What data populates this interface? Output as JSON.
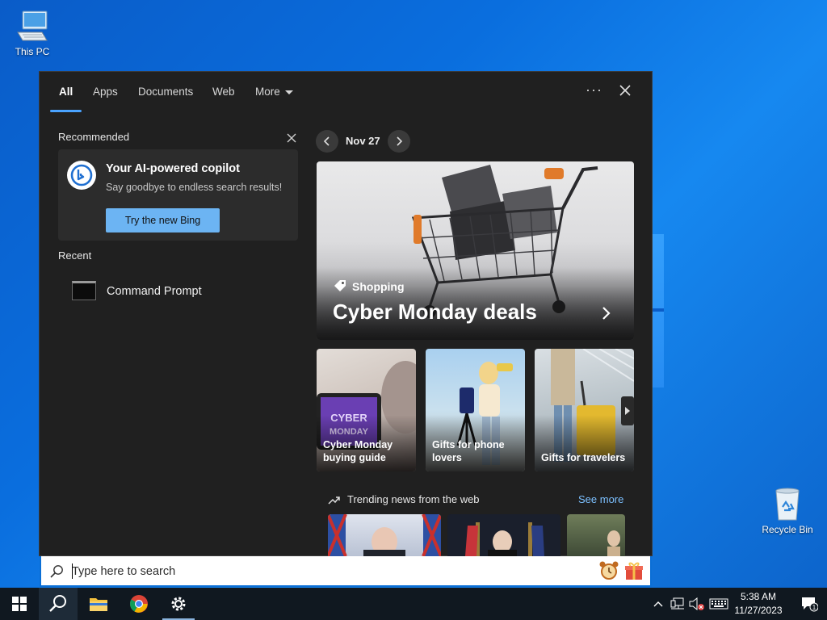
{
  "desktop": {
    "icons": [
      {
        "label": "This PC"
      },
      {
        "label": "Recycle Bin"
      }
    ]
  },
  "search_flyout": {
    "tabs": [
      {
        "label": "All",
        "active": true
      },
      {
        "label": "Apps"
      },
      {
        "label": "Documents"
      },
      {
        "label": "Web"
      },
      {
        "label": "More"
      }
    ],
    "options_label": "···",
    "recommended": {
      "title": "Recommended",
      "card": {
        "title": "Your AI-powered copilot",
        "subtitle": "Say goodbye to endless search results!",
        "button": "Try the new Bing"
      }
    },
    "recent": {
      "title": "Recent",
      "items": [
        {
          "label": "Command Prompt",
          "icon": "command-prompt-icon"
        }
      ]
    },
    "highlights": {
      "date": "Nov 27",
      "hero": {
        "category": "Shopping",
        "title": "Cyber Monday deals"
      },
      "tiles": [
        {
          "label": "Cyber Monday buying guide",
          "overlay_text": "CYBER MONDAY"
        },
        {
          "label": "Gifts for phone lovers"
        },
        {
          "label": "Gifts for travelers"
        }
      ],
      "trending": {
        "title": "Trending news from the web",
        "see_more": "See more"
      }
    }
  },
  "search_box": {
    "placeholder": "Type here to search"
  },
  "taskbar": {
    "apps": [
      "start",
      "search",
      "file-explorer",
      "chrome",
      "settings"
    ],
    "clock": {
      "time": "5:38 AM",
      "date": "11/27/2023"
    },
    "notification_count": "1"
  },
  "colors": {
    "accent": "#4aa3ff",
    "link": "#7cc0ff",
    "bing_button": "#6cb4f3",
    "flyout_bg": "#202020"
  }
}
